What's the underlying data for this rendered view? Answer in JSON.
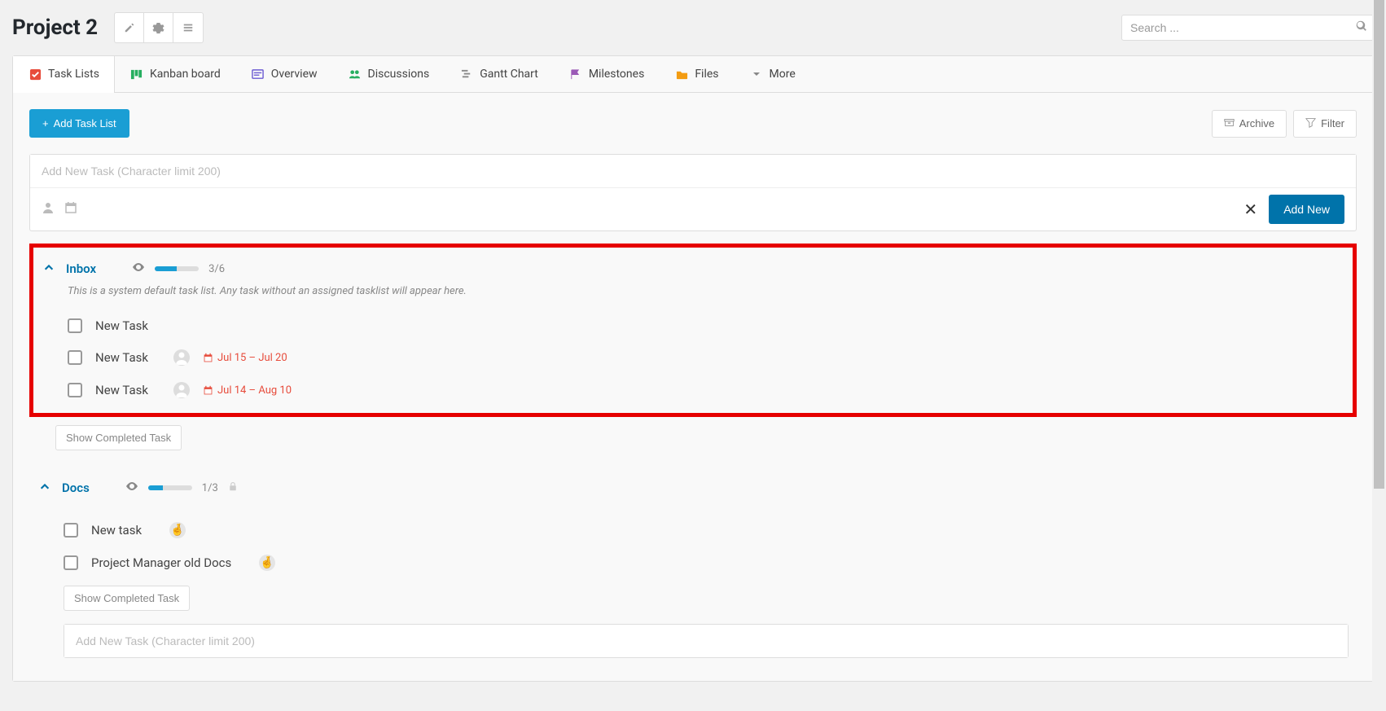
{
  "header": {
    "title": "Project 2",
    "search_placeholder": "Search ..."
  },
  "tabs": [
    {
      "label": "Task Lists",
      "icon": "task-lists-icon",
      "color": "#e74c3c",
      "active": true
    },
    {
      "label": "Kanban board",
      "icon": "kanban-icon",
      "color": "#27ae60"
    },
    {
      "label": "Overview",
      "icon": "overview-icon",
      "color": "#6b5bd2"
    },
    {
      "label": "Discussions",
      "icon": "discussions-icon",
      "color": "#27ae60"
    },
    {
      "label": "Gantt Chart",
      "icon": "gantt-icon",
      "color": "#888"
    },
    {
      "label": "Milestones",
      "icon": "milestones-icon",
      "color": "#9b59b6"
    },
    {
      "label": "Files",
      "icon": "files-icon",
      "color": "#f39c12"
    },
    {
      "label": "More",
      "icon": "more-icon",
      "color": "#888"
    }
  ],
  "actions": {
    "add_task_list": "Add Task List",
    "archive": "Archive",
    "filter": "Filter"
  },
  "new_task_input": {
    "placeholder": "Add New Task (Character limit 200)",
    "add_new": "Add New"
  },
  "tasklists": [
    {
      "title": "Inbox",
      "progress_done": 3,
      "progress_total": 6,
      "progress_pct": 50,
      "progress_text": "3/6",
      "description": "This is a system default task list. Any task without an assigned tasklist will appear here.",
      "highlighted": true,
      "locked": false,
      "tasks": [
        {
          "name": "New Task"
        },
        {
          "name": "New Task",
          "avatar": "silhouette",
          "date": "Jul 15 – Jul 20"
        },
        {
          "name": "New Task",
          "avatar": "silhouette",
          "date": "Jul 14 – Aug 10"
        }
      ],
      "show_completed": "Show Completed Task"
    },
    {
      "title": "Docs",
      "progress_done": 1,
      "progress_total": 3,
      "progress_pct": 33,
      "progress_text": "1/3",
      "highlighted": false,
      "locked": true,
      "tasks": [
        {
          "name": "New task",
          "avatar": "emoji"
        },
        {
          "name": "Project Manager old Docs",
          "avatar": "emoji"
        }
      ],
      "show_completed": "Show Completed Task",
      "bottom_add_placeholder": "Add New Task (Character limit 200)"
    }
  ]
}
